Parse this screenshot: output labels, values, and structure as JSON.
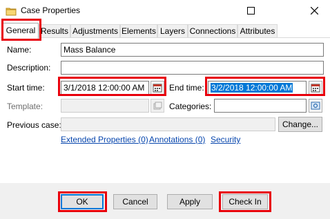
{
  "window": {
    "title": "Case Properties",
    "icon": "folder-icon"
  },
  "tabs": [
    {
      "label": "General",
      "active": true
    },
    {
      "label": "Results"
    },
    {
      "label": "Adjustments"
    },
    {
      "label": "Elements"
    },
    {
      "label": "Layers"
    },
    {
      "label": "Connections"
    },
    {
      "label": "Attributes"
    }
  ],
  "form": {
    "name_label": "Name:",
    "name_value": "Mass Balance",
    "description_label": "Description:",
    "description_value": "",
    "start_label": "Start time:",
    "start_value": "3/1/2018 12:00:00 AM",
    "end_label": "End time:",
    "end_value": "3/2/2018 12:00:00 AM",
    "template_label": "Template:",
    "template_value": "",
    "categories_label": "Categories:",
    "categories_value": "",
    "previous_label": "Previous case:",
    "previous_value": "",
    "change_button": "Change..."
  },
  "links": {
    "extended": "Extended Properties (0)",
    "annotations": "Annotations (0)",
    "security": "Security"
  },
  "buttons": {
    "ok": "OK",
    "cancel": "Cancel",
    "apply": "Apply",
    "checkin": "Check In"
  },
  "colors": {
    "highlight": "#e8000b",
    "selection": "#0078d7",
    "link": "#0645ad"
  }
}
